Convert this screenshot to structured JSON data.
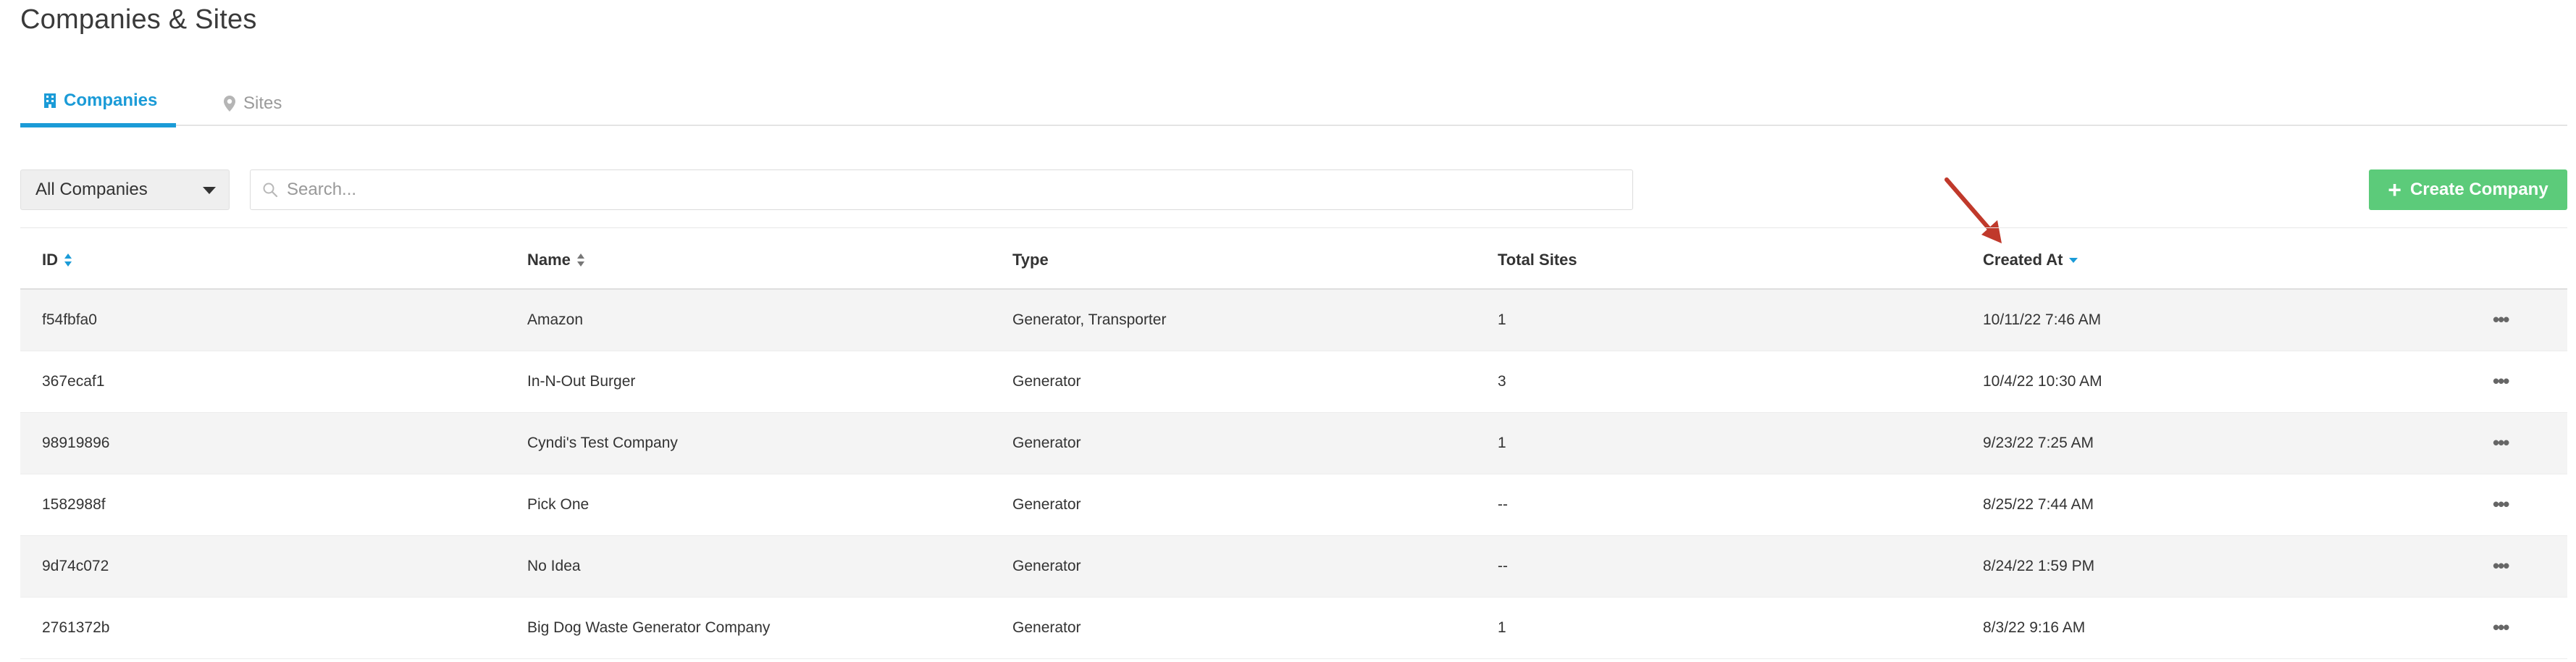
{
  "page": {
    "title": "Companies & Sites"
  },
  "tabs": [
    {
      "label": "Companies",
      "icon": "building-icon",
      "active": true
    },
    {
      "label": "Sites",
      "icon": "map-pin-icon",
      "active": false
    }
  ],
  "toolbar": {
    "filter_value": "All Companies",
    "search_placeholder": "Search...",
    "create_label": "Create Company"
  },
  "table": {
    "columns": [
      "ID",
      "Name",
      "Type",
      "Total Sites",
      "Created At"
    ],
    "rows": [
      {
        "id": "f54fbfa0",
        "name": "Amazon",
        "type": "Generator, Transporter",
        "sites": "1",
        "created": "10/11/22 7:46 AM"
      },
      {
        "id": "367ecaf1",
        "name": "In-N-Out Burger",
        "type": "Generator",
        "sites": "3",
        "created": "10/4/22 10:30 AM"
      },
      {
        "id": "98919896",
        "name": "Cyndi's Test Company",
        "type": "Generator",
        "sites": "1",
        "created": "9/23/22 7:25 AM"
      },
      {
        "id": "1582988f",
        "name": "Pick One",
        "type": "Generator",
        "sites": "--",
        "created": "8/25/22 7:44 AM"
      },
      {
        "id": "9d74c072",
        "name": "No Idea",
        "type": "Generator",
        "sites": "--",
        "created": "8/24/22 1:59 PM"
      },
      {
        "id": "2761372b",
        "name": "Big Dog Waste Generator Company",
        "type": "Generator",
        "sites": "1",
        "created": "8/3/22 9:16 AM"
      }
    ],
    "row_action_icon": "more-horizontal-icon"
  },
  "colors": {
    "accent_blue": "#1b9bd7",
    "create_green": "#5ccb7a",
    "annotation_arrow": "#c0392b"
  }
}
